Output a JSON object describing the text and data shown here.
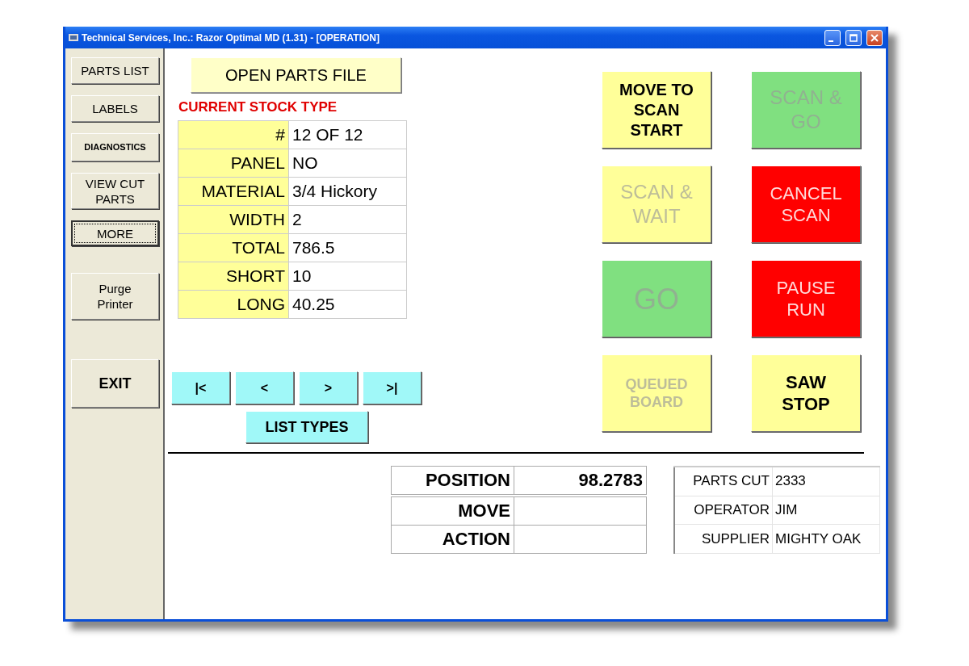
{
  "window": {
    "title": "Technical Services, Inc.: Razor Optimal MD (1.31) - [OPERATION]"
  },
  "sidebar": {
    "buttons": [
      {
        "label": "PARTS LIST",
        "focused": false
      },
      {
        "label": "LABELS",
        "focused": false
      },
      {
        "label": "DIAGNOSTICS",
        "focused": false
      },
      {
        "label": "VIEW CUT PARTS",
        "focused": false
      },
      {
        "label": "MORE",
        "focused": true
      },
      {
        "label": "Purge Printer",
        "focused": false
      },
      {
        "label": "EXIT",
        "focused": false
      }
    ]
  },
  "open_button": "OPEN PARTS FILE",
  "stock_heading": "CURRENT STOCK TYPE",
  "stock_table": [
    {
      "label": "#",
      "value": "12 OF 12"
    },
    {
      "label": "PANEL",
      "value": "NO"
    },
    {
      "label": "MATERIAL",
      "value": "3/4 Hickory"
    },
    {
      "label": "WIDTH",
      "value": "2"
    },
    {
      "label": "TOTAL",
      "value": "786.5"
    },
    {
      "label": "SHORT",
      "value": "10"
    },
    {
      "label": "LONG",
      "value": "40.25"
    }
  ],
  "nav_buttons": [
    "|<",
    "<",
    ">",
    ">|"
  ],
  "list_types_button": "LIST TYPES",
  "action_buttons": [
    {
      "label": "MOVE TO SCAN START",
      "color": "#ffff99",
      "disabled": false
    },
    {
      "label": "SCAN & WAIT",
      "color": "#ffff99",
      "disabled": true
    },
    {
      "label": "GO",
      "color": "#80e080",
      "disabled": true
    },
    {
      "label": "QUEUED BOARD",
      "color": "#ffff99",
      "disabled": true
    },
    {
      "label": "SCAN & GO",
      "color": "#80e080",
      "disabled": true
    },
    {
      "label": "CANCEL SCAN",
      "color": "#ff0000",
      "disabled": true
    },
    {
      "label": "PAUSE RUN",
      "color": "#ff0000",
      "disabled": true
    },
    {
      "label": "SAW STOP",
      "color": "#ffff99",
      "disabled": false
    }
  ],
  "position_table": [
    {
      "label": "POSITION",
      "value": "98.2783"
    },
    {
      "label": "MOVE"
    },
    {
      "label": "ACTION"
    }
  ],
  "stats_table": [
    {
      "label": "PARTS CUT",
      "value": "2333"
    },
    {
      "label": "OPERATOR",
      "value": "JIM"
    },
    {
      "label": "SUPPLIER",
      "value": "MIGHTY OAK"
    }
  ]
}
